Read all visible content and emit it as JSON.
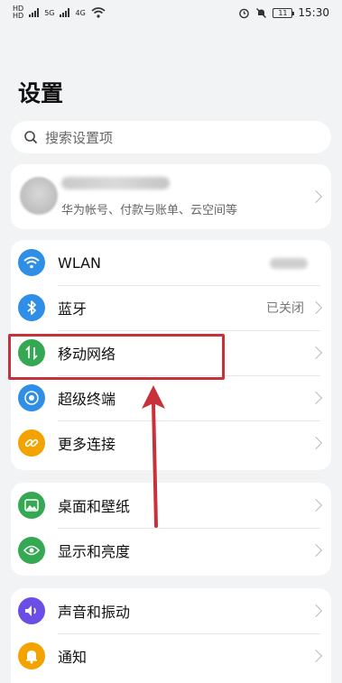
{
  "status_bar": {
    "left_labels": [
      "HD",
      "HD"
    ],
    "signal_labels": [
      "5G",
      "4G"
    ],
    "time": "15:30",
    "battery": "11"
  },
  "page": {
    "title": "设置"
  },
  "search": {
    "placeholder": "搜索设置项"
  },
  "account": {
    "subtitle": "华为帐号、付款与账单、云空间等"
  },
  "network_group": {
    "items": [
      {
        "label": "WLAN",
        "value": "",
        "icon": "wifi-icon",
        "color": "#2f8fe6"
      },
      {
        "label": "蓝牙",
        "value": "已关闭",
        "icon": "bluetooth-icon",
        "color": "#2f8fe6"
      },
      {
        "label": "移动网络",
        "value": "",
        "icon": "mobile-data-icon",
        "color": "#34a853"
      },
      {
        "label": "超级终端",
        "value": "",
        "icon": "super-device-icon",
        "color": "#2f8fe6"
      },
      {
        "label": "更多连接",
        "value": "",
        "icon": "link-icon",
        "color": "#f2a300"
      }
    ]
  },
  "display_group": {
    "items": [
      {
        "label": "桌面和壁纸",
        "icon": "wallpaper-icon",
        "color": "#34a853"
      },
      {
        "label": "显示和亮度",
        "icon": "eye-icon",
        "color": "#34a853"
      }
    ]
  },
  "sound_group": {
    "items": [
      {
        "label": "声音和振动",
        "icon": "sound-icon",
        "color": "#6b4ee6"
      },
      {
        "label": "通知",
        "icon": "bell-icon",
        "color": "#f2a300"
      }
    ]
  },
  "annotation": {
    "highlight_color": "#c8313a"
  }
}
